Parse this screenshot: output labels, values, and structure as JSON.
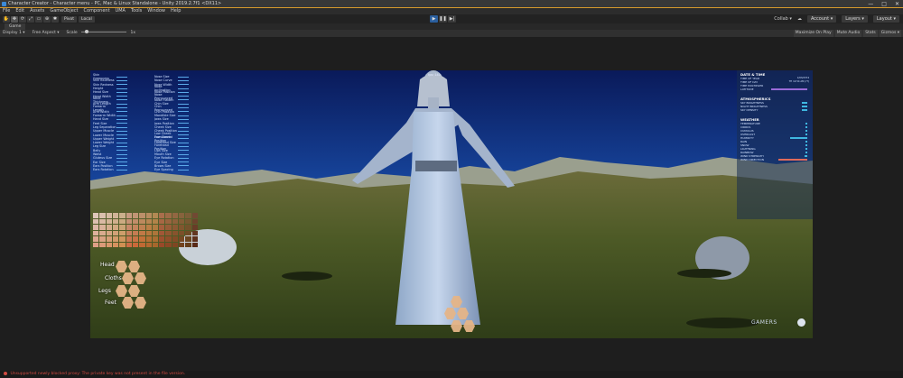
{
  "window": {
    "title": "Character Creator - Character menu - PC, Mac & Linux Standalone - Unity 2019.2.7f1 <DX11>",
    "buttons": [
      "—",
      "□",
      "✕"
    ]
  },
  "menu": [
    "File",
    "Edit",
    "Assets",
    "GameObject",
    "Component",
    "UMA",
    "Tools",
    "Window",
    "Help"
  ],
  "toolbar": {
    "tools": [
      "✋",
      "✥",
      "⟳",
      "⤢",
      "▭",
      "⊕",
      "✱"
    ],
    "pivot": "Pivot",
    "local": "Local",
    "play": [
      "▶",
      "❚❚",
      "▶|"
    ],
    "collab": "Collab ▾",
    "cloud": "☁",
    "account": "Account ▾",
    "layers": "Layers ▾",
    "layout": "Layout ▾"
  },
  "game_tab": "Game",
  "game_bar": {
    "display": "Display 1 ▾",
    "aspect": "Free Aspect ▾",
    "scale_label": "Scale",
    "scale_value": "1x",
    "right": [
      "Maximize On Play",
      "Mute Audio",
      "Stats",
      "Gizmos ▾"
    ]
  },
  "hud": {
    "fps": "fps: 140",
    "left_sliders": [
      "Skin Greenness",
      "Skin Blueness",
      "Skin Redness",
      "Height",
      "Head Size",
      "Head Width",
      "Neck Thickness",
      "Arm Length",
      "Forearm Length",
      "Arm Width",
      "Forearm Width",
      "Hand Size",
      "Feet Size",
      "Leg Separation",
      "Upper Muscle",
      "Lower Muscle",
      "Upper Weight",
      "Lower Weight",
      "Leg Size",
      "Belly",
      "Waist",
      "Gluteus Size",
      "Ear Size",
      "Ears Position",
      "Ears Rotation"
    ],
    "mid_sliders": [
      "Nose Size",
      "Nose Curve",
      "Nose Width",
      "Nose Inclination",
      "Nose Position",
      "Nose Pronounced",
      "Nose Flatten",
      "Chin Size",
      "Chin Pronounced",
      "Chin Position",
      "Mandible Size",
      "Jaws Size",
      "Jaws Position",
      "Cheek Size",
      "Cheek Position",
      "Low Cheek Pronounced",
      "Low Cheek Position",
      "Forehead Size",
      "Forehead Position",
      "Lips Size",
      "Mouth Size",
      "Eye Rotation",
      "Eye Size",
      "Brows Size",
      "Eye Spacing"
    ]
  },
  "weather_panel": {
    "date_header": "DATE & TIME",
    "date_items": [
      "TIME OF YEAR",
      "TIME OF DAY",
      "TIME MULTIPLIER",
      "LATITUDE"
    ],
    "time_of_year_value": "1/03/2374",
    "time_of_day_value": "TH 12:54 AM (??)",
    "atmos_header": "ATMOSPHERICS",
    "atmos_items": [
      "SKY BRIGHTNESS",
      "NIGHT BRIGHTNESS",
      "SKY DENSITY"
    ],
    "weather_header": "WEATHER",
    "weather_items": [
      "TEMPERATURE",
      "CIRRUS",
      "CUMULUS",
      "OVERCAST",
      "HUMIDITY",
      "RAIN",
      "SNOW",
      "LIGHTNING",
      "RAINBOW",
      "WIND STRENGTH",
      "WIND DIRECTION"
    ],
    "weather_levels": [
      0.05,
      0.05,
      0.05,
      0.05,
      0.55,
      0.05,
      0.05,
      0.05,
      0.05,
      0.1,
      0.95
    ],
    "accent_colors": [
      "#3fb7e0",
      "#9a6bd8",
      "#e06a5a"
    ]
  },
  "wardrobe": {
    "labels": [
      "Head",
      "Cloths",
      "Legs",
      "Feet"
    ]
  },
  "logo_text": "GAMERS",
  "status": "Unsupported newly blocked proxy: The private key was not present in the file version."
}
